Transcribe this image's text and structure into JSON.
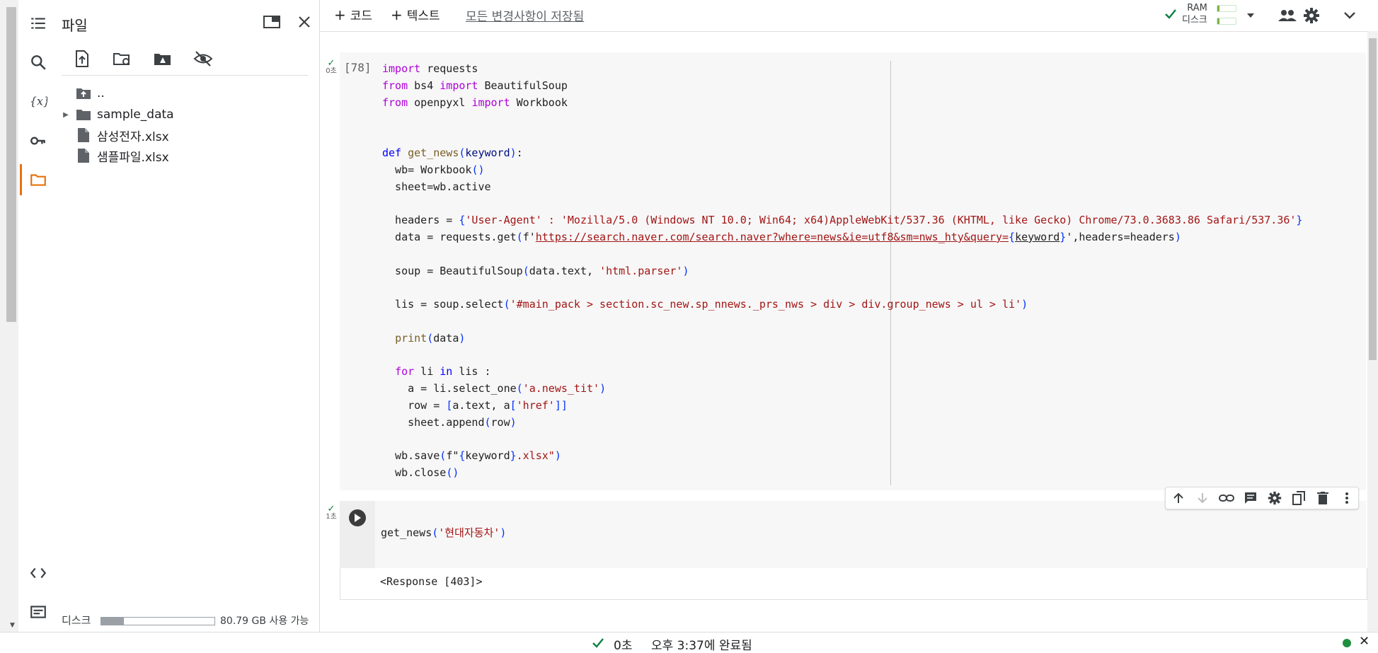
{
  "files_panel": {
    "title": "파일",
    "tree": [
      {
        "label": "..",
        "icon": "folder-up-icon"
      },
      {
        "label": "sample_data",
        "icon": "folder-icon",
        "expandable": true
      },
      {
        "label": "삼성전자.xlsx",
        "icon": "file-icon"
      },
      {
        "label": "샘플파일.xlsx",
        "icon": "file-icon"
      }
    ],
    "disk_label": "디스크",
    "disk_free": "80.79 GB 사용 가능",
    "disk_used_fraction": 0.2
  },
  "toolbar": {
    "add_code": "코드",
    "add_text": "텍스트",
    "save_status": "모든 변경사항이 저장됨",
    "ram_label": "RAM",
    "disk_label": "디스크"
  },
  "cells": [
    {
      "exec_count": "[78]",
      "run_time": "0초",
      "status": "completed"
    },
    {
      "exec_count": "",
      "run_time": "1초",
      "status": "completed",
      "output": "<Response [403]>"
    }
  ],
  "statusbar": {
    "elapsed": "0초",
    "completed_text": "오후 3:37에 완료됨"
  },
  "colors": {
    "accent": "#e8710a",
    "success": "#0a8043",
    "keyword": "#af00db",
    "string": "#a31515",
    "function": "#795e26"
  }
}
